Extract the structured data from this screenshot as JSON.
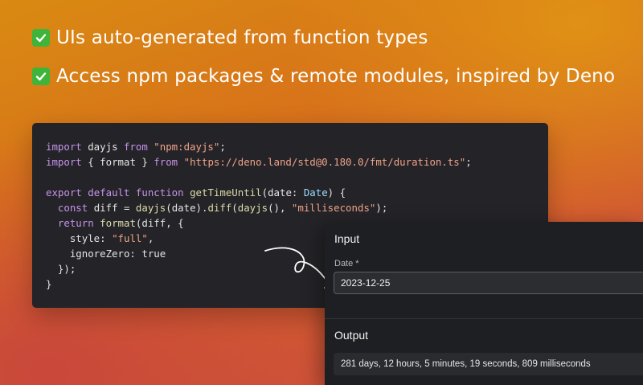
{
  "headlines": [
    {
      "icon": "check-mark-icon",
      "text": "UIs auto-generated from function types"
    },
    {
      "icon": "check-mark-icon",
      "text": "Access npm packages & remote modules, inspired by Deno"
    }
  ],
  "colors": {
    "check_green": "#3fb43a",
    "code_bg": "#242428",
    "panel_bg": "#1e1f22"
  },
  "code": {
    "line1": {
      "a": "import",
      "b": " dayjs ",
      "c": "from",
      "d": " ",
      "e": "\"npm:dayjs\"",
      "f": ";"
    },
    "line2": {
      "a": "import",
      "b": " { format } ",
      "c": "from",
      "d": " ",
      "e": "\"https://deno.land/std@0.180.0/fmt/duration.ts\"",
      "f": ";"
    },
    "line4": {
      "a": "export",
      "b": " ",
      "c": "default",
      "d": " ",
      "e": "function",
      "f": " ",
      "g": "getTimeUntil",
      "h": "(date: ",
      "i": "Date",
      "j": ") {"
    },
    "line5": {
      "a": "  ",
      "b": "const",
      "c": " diff = ",
      "d": "dayjs",
      "e": "(date).",
      "f": "diff",
      "g": "(",
      "h": "dayjs",
      "i": "(), ",
      "j": "\"milliseconds\"",
      "k": ");"
    },
    "line6": {
      "a": "  ",
      "b": "return",
      "c": " ",
      "d": "format",
      "e": "(diff, {"
    },
    "line7": {
      "a": "    style: ",
      "b": "\"full\"",
      "c": ","
    },
    "line8": {
      "a": "    ignoreZero: ",
      "b": "true"
    },
    "line9": {
      "a": "  });"
    },
    "line10": {
      "a": "}"
    }
  },
  "input_section": {
    "title": "Input",
    "field_label": "Date *",
    "field_value": "2023-12-25"
  },
  "output_section": {
    "title": "Output",
    "value": "281 days, 12 hours, 5 minutes, 19 seconds, 809 milliseconds"
  }
}
